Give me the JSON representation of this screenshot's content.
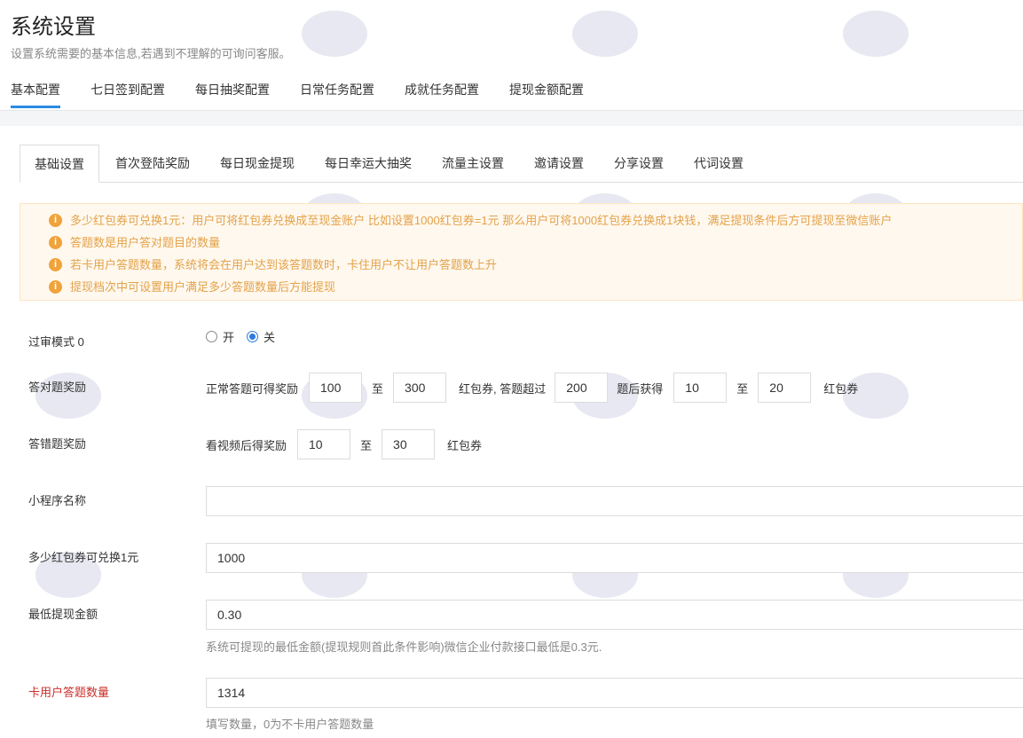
{
  "header": {
    "title": "系统设置",
    "subtitle": "设置系统需要的基本信息,若遇到不理解的可询问客服。"
  },
  "top_tabs": [
    "基本配置",
    "七日签到配置",
    "每日抽奖配置",
    "日常任务配置",
    "成就任务配置",
    "提现金额配置"
  ],
  "inner_tabs": [
    "基础设置",
    "首次登陆奖励",
    "每日现金提现",
    "每日幸运大抽奖",
    "流量主设置",
    "邀请设置",
    "分享设置",
    "代词设置"
  ],
  "notices": [
    "多少红包券可兑换1元：用户可将红包券兑换成至现金账户 比如设置1000红包券=1元 那么用户可将1000红包券兑换成1块钱，满足提现条件后方可提现至微信账户",
    "答题数是用户答对题目的数量",
    "若卡用户答题数量，系统将会在用户达到该答题数时，卡住用户不让用户答题数上升",
    "提现档次中可设置用户满足多少答题数量后方能提现"
  ],
  "review_mode": {
    "label": "过审模式 0",
    "on_label": "开",
    "off_label": "关",
    "selected": "关"
  },
  "correct_reward": {
    "label": "答对题奖励",
    "text1": "正常答题可得奖励",
    "min": "100",
    "to1": "至",
    "max": "300",
    "text2": "红包券, 答题超过",
    "threshold": "200",
    "text3": "题后获得",
    "min2": "10",
    "to2": "至",
    "max2": "20",
    "text4": "红包券"
  },
  "wrong_reward": {
    "label": "答错题奖励",
    "text1": "看视频后得奖励",
    "min": "10",
    "to": "至",
    "max": "30",
    "text2": "红包券"
  },
  "mini_program_name": {
    "label": "小程序名称",
    "value": ""
  },
  "exchange_rate": {
    "label": "多少红包券可兑换1元",
    "value": "1000"
  },
  "min_withdraw": {
    "label": "最低提现金额",
    "value": "0.30",
    "help": "系统可提现的最低金额(提现规则首此条件影响)微信企业付款接口最低是0.3元."
  },
  "block_answers": {
    "label": "卡用户答题数量",
    "value": "1314",
    "help": "填写数量，0为不卡用户答题数量"
  },
  "colors": {
    "accent": "#2c8be3",
    "notice_text": "#e3a24a",
    "notice_bg": "#fff8ee",
    "red_label": "#c9302c"
  },
  "icons": {
    "notice": "info-circle-icon"
  }
}
